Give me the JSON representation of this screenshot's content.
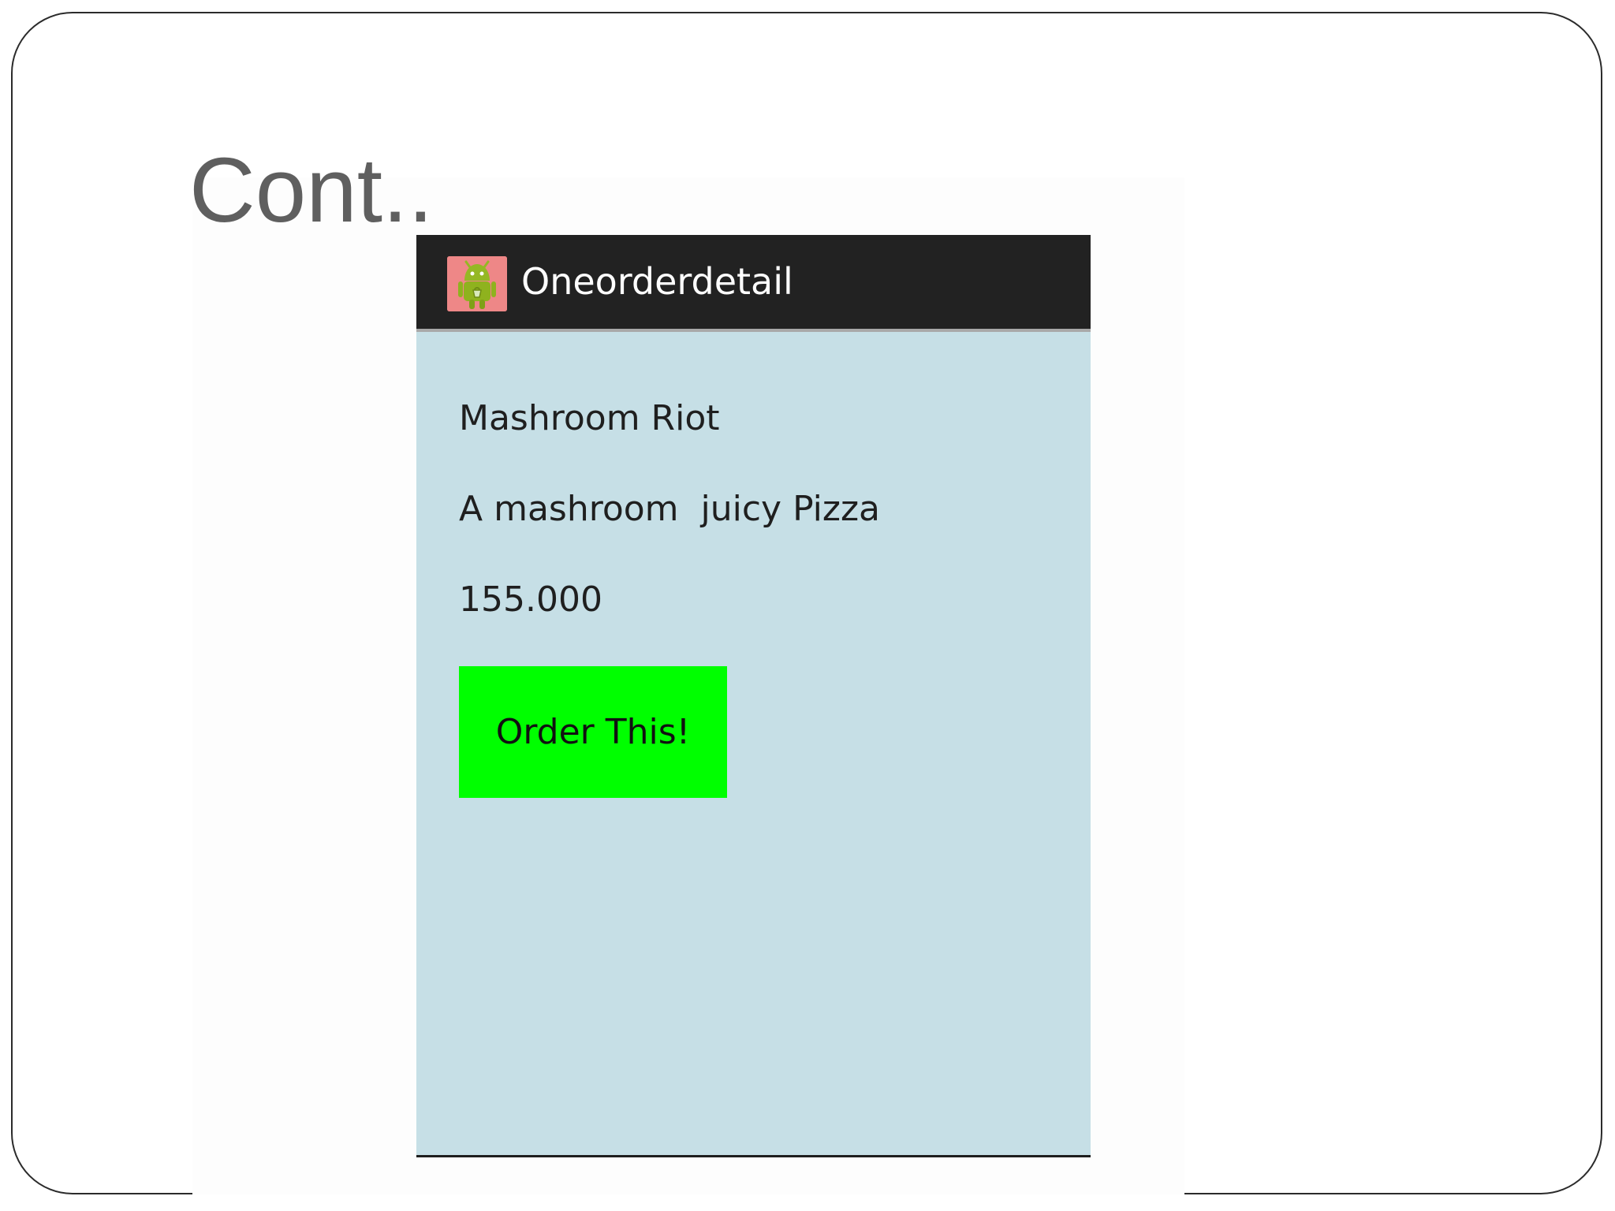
{
  "slide": {
    "title": "Cont.."
  },
  "app": {
    "title": "Oneorderdetail",
    "icon": "android-app-icon"
  },
  "order_detail": {
    "name": "Mashroom Riot",
    "description": "A mashroom  juicy Pizza",
    "price": "155.000",
    "order_button_label": "Order This!"
  },
  "colors": {
    "action_bar": "#222222",
    "content_background": "#c6dfe6",
    "button": "#00ff00",
    "app_icon_background": "#ee8787",
    "slide_title": "#5f5f5f"
  }
}
